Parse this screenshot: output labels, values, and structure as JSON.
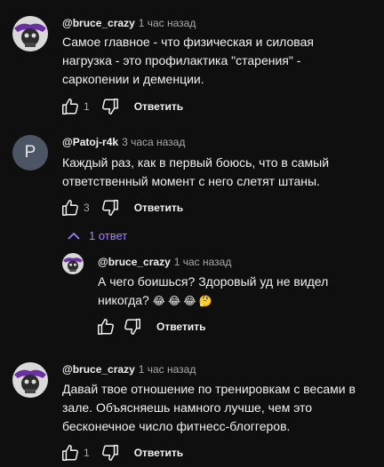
{
  "comments": [
    {
      "author": "@bruce_crazy",
      "time": "1 час назад",
      "text": "Самое главное - что физическая и силовая нагрузка - это профилактика \"старения\" - саркопении и деменции.",
      "likes": "1",
      "reply_label": "Ответить",
      "avatar": "skull-bat-avatar"
    },
    {
      "author": "@Patoj-r4k",
      "time": "3 часа назад",
      "text": "Каждый раз, как в первый боюсь, что в самый ответственный момент с него слетят штаны.",
      "likes": "3",
      "reply_label": "Ответить",
      "avatar_letter": "P"
    },
    {
      "author": "@bruce_crazy",
      "time": "1 час назад",
      "text": "Давай твое отношение по тренировкам с весами в зале. Объясняешь намного лучше, чем это бесконечное число фитнесс-блоггеров.",
      "likes": "1",
      "reply_label": "Ответить",
      "avatar": "skull-bat-avatar"
    }
  ],
  "replies_toggle": "1 ответ",
  "reply": {
    "author": "@bruce_crazy",
    "time": "1 час назад",
    "text": "А чего боишься? Здоровый уд не видел никогда?",
    "emojis": "😂 😂 😂 🤔",
    "reply_label": "Ответить",
    "avatar": "skull-bat-avatar"
  },
  "colors": {
    "background": "#0f0f0f",
    "text": "#f1f1f1",
    "secondary": "#aaaaaa",
    "toggle": "#a883ff"
  }
}
